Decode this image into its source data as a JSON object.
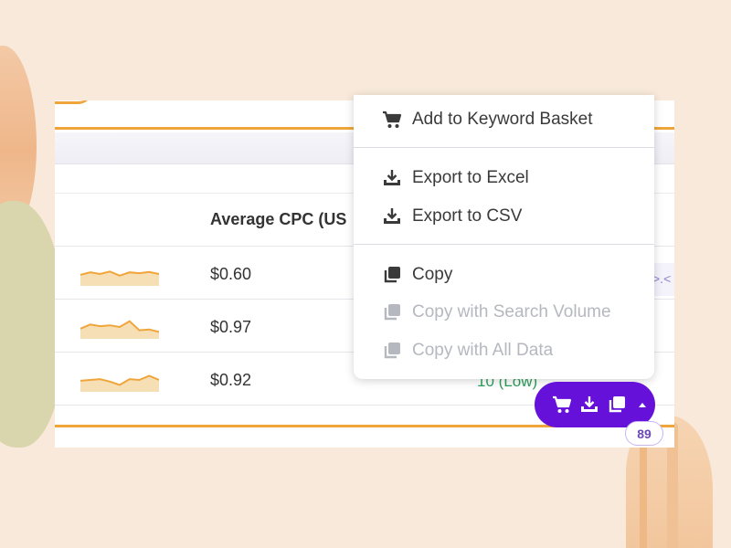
{
  "table": {
    "column_header": "Average CPC (US",
    "rows": [
      {
        "cpc": "$0.60",
        "trend": [
          0.45,
          0.6,
          0.5,
          0.65,
          0.4,
          0.6,
          0.55,
          0.62,
          0.5
        ]
      },
      {
        "cpc": "$0.97",
        "trend": [
          0.4,
          0.65,
          0.55,
          0.6,
          0.5,
          0.85,
          0.3,
          0.35,
          0.2
        ]
      },
      {
        "cpc": "$0.92",
        "trend": [
          0.45,
          0.5,
          0.55,
          0.4,
          0.2,
          0.55,
          0.5,
          0.75,
          0.5
        ]
      }
    ],
    "visible_competition": "10 (Low)",
    "edge_chip": ">.<"
  },
  "menu": {
    "items": [
      {
        "label": "Add to Keyword Basket",
        "icon": "cart-icon",
        "enabled": true
      },
      {
        "label": "Export to Excel",
        "icon": "download-icon",
        "enabled": true
      },
      {
        "label": "Export to CSV",
        "icon": "download-icon",
        "enabled": true
      },
      {
        "label": "Copy",
        "icon": "copy-icon",
        "enabled": true
      },
      {
        "label": "Copy with Search Volume",
        "icon": "copy-icon",
        "enabled": false
      },
      {
        "label": "Copy with All Data",
        "icon": "copy-icon",
        "enabled": false
      }
    ]
  },
  "action_bar": {
    "icons": [
      "cart-icon",
      "download-icon",
      "copy-icon",
      "caret-up-icon"
    ],
    "count": "89"
  },
  "colors": {
    "accent_purple": "#6511d9",
    "accent_orange": "#f0a53b",
    "competition_low": "#2e9e5b",
    "disabled_text": "#b6b8c0"
  }
}
